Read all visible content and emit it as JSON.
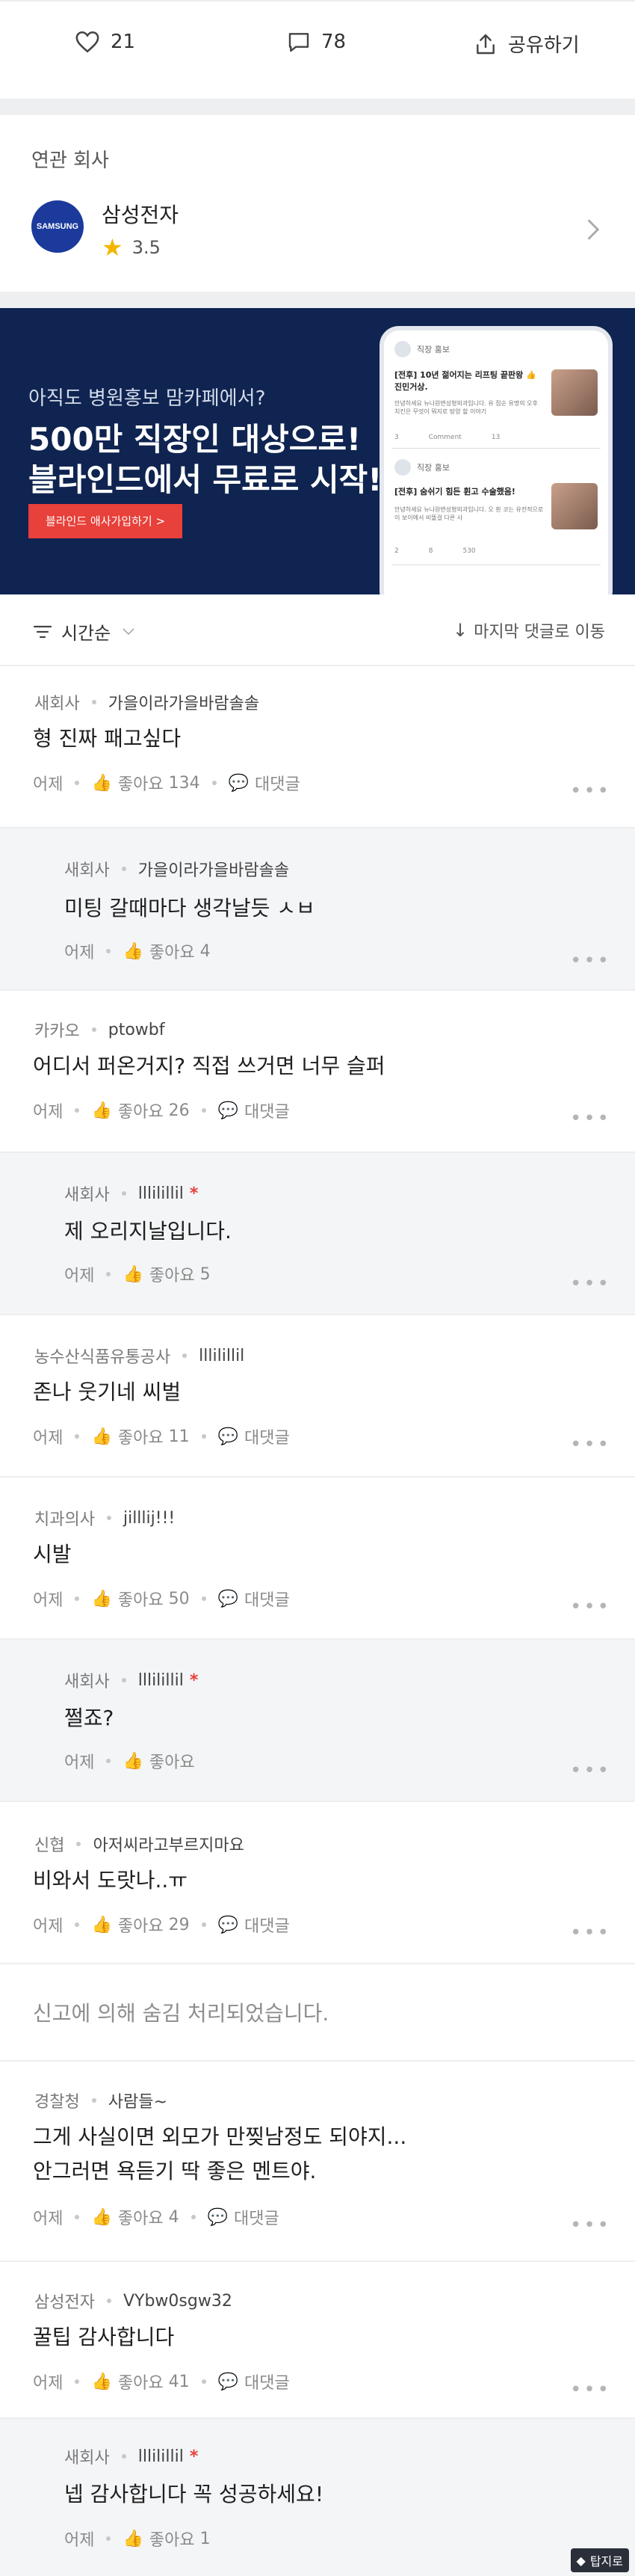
{
  "actions": {
    "like_count": "21",
    "comment_count": "78",
    "share_label": "공유하기"
  },
  "related": {
    "section_title": "연관 회사",
    "company_name": "삼성전자",
    "logo_text": "SAMSUNG",
    "rating": "3.5"
  },
  "banner": {
    "line1": "아직도 병원홍보 맘카페에서?",
    "line2": "500만 직장인 대상으로!",
    "line3": "블라인드에서 무료로 시작!",
    "cta": "블라인드 애사가입하기 >",
    "phone": {
      "header_name": "직장 홍보",
      "post1_title": "[전후] 10년 젊어지는 리프팅 끝판왕 👍 진민거상.",
      "post1_body": "안녕하세요 뉴나원변성형외과입니다. 유 점순 유명의 오후 치킨은 무엇이 뭐지로 탕양 할 이야기",
      "post1_comment": "Comment",
      "post1_like": "3",
      "post1_views": "13",
      "post2_header": "직장 홍보",
      "post2_title": "[전후] 숨쉬기 힘든 휜고 수술했음!",
      "post2_body": "안녕하세요 뉴나원변성형외과입니다. 오 휜 코는 유전적으로 이 보이에서 비뚤걸 다른 사",
      "post2_like": "2",
      "post2_comment": "8",
      "post2_views": "530"
    },
    "accent": "#e8403a"
  },
  "sort": {
    "label": "시간순",
    "jump_label": "마지막 댓글로 이동"
  },
  "labels": {
    "like": "좋아요",
    "reply": "대댓글",
    "author_mark": "*"
  },
  "comments": [
    {
      "company": "새회사",
      "nick": "가을이라가을바람솔솔",
      "text": "형 진짜 패고싶다",
      "time": "어제",
      "likes": "134",
      "reply": true
    },
    {
      "company": "새회사",
      "nick": "가을이라가을바람솔솔",
      "text": "미팅 갈때마다 생각날듯 ㅅㅂ",
      "time": "어제",
      "likes": "4",
      "reply": false
    },
    {
      "company": "카카오",
      "nick": "ptowbf",
      "text": "어디서 퍼온거지? 직접 쓰거면 너무 슬퍼",
      "time": "어제",
      "likes": "26",
      "reply": true
    },
    {
      "company": "새회사",
      "nick": "lllilillil",
      "text": "제 오리지날입니다.",
      "time": "어제",
      "likes": "5",
      "reply": false
    },
    {
      "company": "농수산식품유통공사",
      "nick": "lllilillil",
      "text": "존나 웃기네 씨벌",
      "time": "어제",
      "likes": "11",
      "reply": true
    },
    {
      "company": "치과의사",
      "nick": "jilllij!!!",
      "text": "시발",
      "time": "어제",
      "likes": "50",
      "reply": true
    },
    {
      "company": "새회사",
      "nick": "lllilillil",
      "text": "쩔죠?",
      "time": "어제",
      "likes": "",
      "reply": false
    },
    {
      "company": "신협",
      "nick": "아저씨라고부르지마요",
      "text": "비와서 도랏나..ㅠ",
      "time": "어제",
      "likes": "29",
      "reply": true
    },
    {
      "hidden_text": "신고에 의해 숨김 처리되었습니다."
    },
    {
      "company": "경찰청",
      "nick": "사람들~",
      "text_line1": "그게 사실이면 외모가 만찢남정도 되야지...",
      "text_line2": "안그러면 욕듣기 딱 좋은 멘트야.",
      "time": "어제",
      "likes": "4",
      "reply": true
    },
    {
      "company": "삼성전자",
      "nick": "VYbw0sgw32",
      "text": "꿀팁 감사합니다",
      "time": "어제",
      "likes": "41",
      "reply": true
    },
    {
      "company": "새회사",
      "nick": "lllilillil",
      "text": "넵 감사합니다 꼭 성공하세요!",
      "time": "어제",
      "likes": "1",
      "reply": false
    }
  ],
  "watermark": "탑지로"
}
